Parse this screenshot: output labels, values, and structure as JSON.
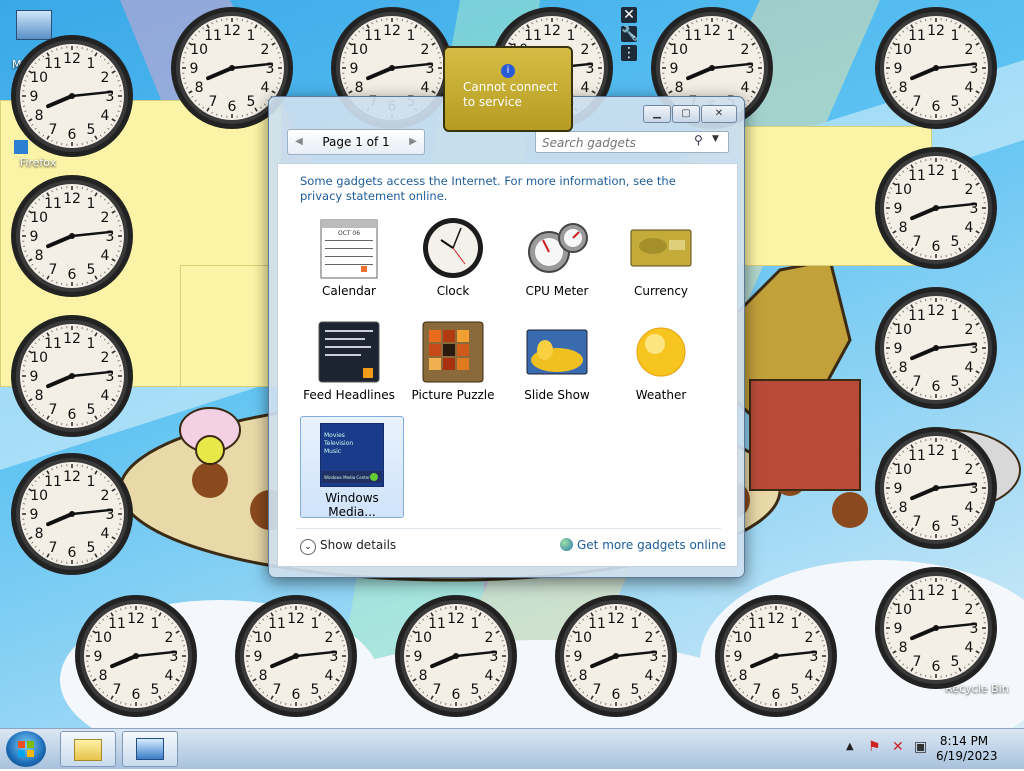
{
  "desktop": {
    "icons": [
      {
        "label": "My",
        "name": "my-computer"
      },
      {
        "label": "Firefox",
        "name": "firefox"
      },
      {
        "label": "Recycle Bin",
        "name": "recycle-bin"
      }
    ]
  },
  "clock_face": {
    "numbers": [
      "12",
      "1",
      "2",
      "3",
      "4",
      "5",
      "6",
      "7",
      "8",
      "9",
      "10",
      "11"
    ]
  },
  "gadget_window": {
    "pager": {
      "label": "Page 1 of 1"
    },
    "search": {
      "placeholder": "Search gadgets"
    },
    "notice": "Some gadgets access the Internet.  For more information, see the privacy statement online.",
    "gadgets": [
      {
        "label": "Calendar",
        "icon": "calendar-icon"
      },
      {
        "label": "Clock",
        "icon": "clock-icon"
      },
      {
        "label": "CPU Meter",
        "icon": "cpu-meter-icon"
      },
      {
        "label": "Currency",
        "icon": "currency-icon"
      },
      {
        "label": "Feed Headlines",
        "icon": "feed-headlines-icon"
      },
      {
        "label": "Picture Puzzle",
        "icon": "picture-puzzle-icon"
      },
      {
        "label": "Slide Show",
        "icon": "slide-show-icon"
      },
      {
        "label": "Weather",
        "icon": "weather-icon"
      },
      {
        "label": "Windows Media...",
        "icon": "windows-media-center-icon",
        "selected": true
      }
    ],
    "calendar_thumb_label": "OCT 06",
    "wmc_thumb_lines": [
      "Movies",
      "Television",
      "Music"
    ],
    "wmc_thumb_footer": "Windows Media Center",
    "show_details": "Show details",
    "get_more": "Get more gadgets online"
  },
  "currency_tooltip": {
    "text": "Cannot connect to service"
  },
  "taskbar": {
    "time": "8:14 PM",
    "date": "6/19/2023"
  }
}
